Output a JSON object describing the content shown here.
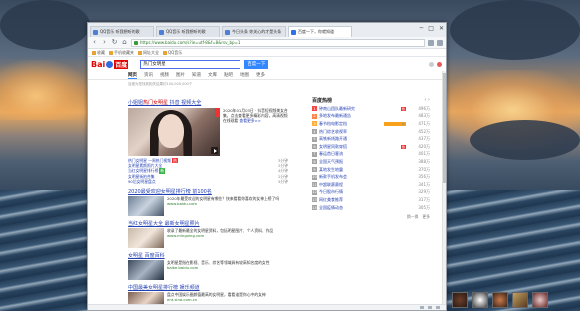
{
  "browser": {
    "tabs": [
      {
        "label": "QQ音乐 听我想听的歌",
        "active": false
      },
      {
        "label": "QQ音乐 听我想听的歌",
        "active": false
      },
      {
        "label": "今日头条 你关心的才是头条",
        "active": false
      },
      {
        "label": "百度一下，你就知道",
        "active": true
      }
    ],
    "window_controls": [
      "─",
      "□",
      "✕"
    ],
    "address": "https://www.baidu.com/s?ie=utf-8&f=8&rsv_bp=1",
    "bookmarks": [
      "收藏",
      "手机收藏夹",
      "网址大全",
      "QQ音乐"
    ]
  },
  "baidu": {
    "logo_left": "Bai",
    "logo_right": "百度",
    "search_value": "热门女明星",
    "search_button": "百度一下",
    "tabs": [
      "网页",
      "资讯",
      "视频",
      "图片",
      "知道",
      "文库",
      "贴吧",
      "地图",
      "更多"
    ],
    "result_info": "百度为您找到相关结果约100,000,000个"
  },
  "results": {
    "first": {
      "title_prefix": "小姐姐",
      "title_em": "热门女明星",
      "title_suffix": " 抖音 视频大全",
      "desc": "2020年01月03日 · 抖音短视频美女合集，点击查看更多精彩内容，高清视频在线观看",
      "desc_link": "查看更多>>",
      "lines": [
        {
          "text": "热门女明星 一周热门视频",
          "time": "3分钟",
          "tag": "热"
        },
        {
          "text": "女明星素颜照片大全",
          "time": "2分钟",
          "tag": ""
        },
        {
          "text": "当红女明星排行榜",
          "time": "4分钟",
          "tag": "新"
        },
        {
          "text": "女明星街拍合集",
          "time": "2分钟",
          "tag": ""
        },
        {
          "text": "90后女明星盘点",
          "time": "5分钟",
          "tag": ""
        }
      ]
    },
    "items": [
      {
        "title": "2020最受欢迎女明星排行榜 前100名",
        "desc": "2020年最受欢迎的女明星有哪些？快来看看你喜欢的女神上榜了吗",
        "src": "www.baidu.com"
      },
      {
        "title": "当红女明星大全 最新女明星照片",
        "desc": "收录了最新最全的女明星资料，包括明星图片、个人资料、作品",
        "src": "www.mingxing.com"
      },
      {
        "title": "女明星 百度百科",
        "desc": "女明星是指在影视、音乐、综艺等领域具有较高知名度的女性",
        "src": "baike.baidu.com"
      },
      {
        "title": "中国最美女明星排行榜 娱乐频道",
        "desc": "盘点中国娱乐圈颜值最高的女明星，看看谁是你心中的女神",
        "src": "ent.sina.com.cn"
      }
    ]
  },
  "hotlist": {
    "title": "百度热榜",
    "nav": "‹ ›",
    "rows": [
      {
        "rank": "1",
        "text": "钟南山团队最新研究",
        "mark": "热",
        "num": "496万"
      },
      {
        "rank": "2",
        "text": "多地发布最新通告",
        "mark": "",
        "num": "483万"
      },
      {
        "rank": "3",
        "text": "春节档电影定档",
        "mark": "新",
        "num": "471万"
      },
      {
        "rank": "4",
        "text": "热门综艺收视率",
        "mark": "",
        "num": "452万"
      },
      {
        "rank": "5",
        "text": "高铁新线路开通",
        "mark": "",
        "num": "437万"
      },
      {
        "rank": "6",
        "text": "女明星同款穿搭",
        "mark": "热",
        "num": "420万"
      },
      {
        "rank": "7",
        "text": "春运首日客流",
        "mark": "",
        "num": "401万"
      },
      {
        "rank": "8",
        "text": "全国天气预报",
        "mark": "",
        "num": "388万"
      },
      {
        "rank": "9",
        "text": "某地发生地震",
        "mark": "",
        "num": "370万"
      },
      {
        "rank": "10",
        "text": "新款手机发布会",
        "mark": "",
        "num": "356万"
      },
      {
        "rank": "11",
        "text": "中超联赛赛程",
        "mark": "",
        "num": "341万"
      },
      {
        "rank": "12",
        "text": "今日股市行情",
        "mark": "",
        "num": "329万"
      },
      {
        "rank": "13",
        "text": "网红美食推荐",
        "mark": "",
        "num": "317万"
      },
      {
        "rank": "14",
        "text": "全国疫情动态",
        "mark": "",
        "num": "305万"
      }
    ],
    "footer": [
      "换一换",
      "更多"
    ]
  }
}
